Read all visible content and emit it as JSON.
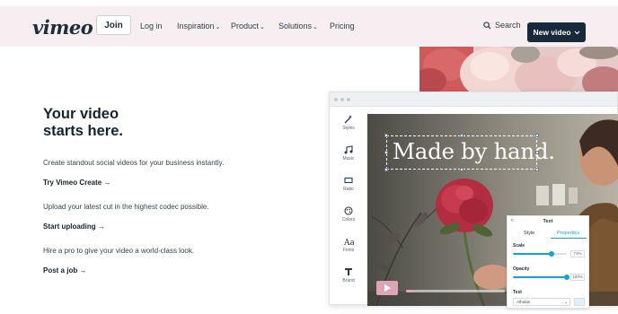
{
  "nav": {
    "logo": "vimeo",
    "join_label": "Join",
    "login_label": "Log in",
    "inspiration_label": "Inspiration",
    "product_label": "Product",
    "solutions_label": "Solutions",
    "pricing_label": "Pricing",
    "search_label": "Search",
    "new_video_label": "New video",
    "chevron": "⌄"
  },
  "hero": {
    "headline_line1": "Your video",
    "headline_line2": "starts here.",
    "item1_text": "Create standout social videos for your business instantly.",
    "item1_cta": "Try Vimeo Create →",
    "item2_text": "Upload your latest cut in the highest codec possible.",
    "item2_cta": "Start uploading →",
    "item3_text": "Hire a pro to give your video a world-class look.",
    "item3_cta": "Post a job →"
  },
  "editor": {
    "tools": [
      {
        "label": "Styles",
        "icon": "magic-wand-icon"
      },
      {
        "label": "Music",
        "icon": "music-note-icon"
      },
      {
        "label": "Ratio",
        "icon": "ratio-icon"
      },
      {
        "label": "Colors",
        "icon": "palette-icon"
      },
      {
        "label": "Fonts",
        "icon": "font-icon"
      },
      {
        "label": "Brand",
        "icon": "brand-icon"
      }
    ],
    "overlay_text": "Made by hand.",
    "panel": {
      "title": "Text",
      "tab_style": "Style",
      "tab_properties": "Properties",
      "scale_label": "Scale",
      "scale_value": "71%",
      "scale_fraction": 0.71,
      "opacity_label": "Opacity",
      "opacity_value": "100%",
      "opacity_fraction": 1.0,
      "font_label": "Text",
      "font_value": "Atholas"
    },
    "progress_fraction": 0.08
  },
  "colors": {
    "nav_bg": "#f7eef1",
    "button_dark": "#182a3a",
    "accent_blue": "#17a3d0",
    "play_pink": "#e0a4b7"
  }
}
